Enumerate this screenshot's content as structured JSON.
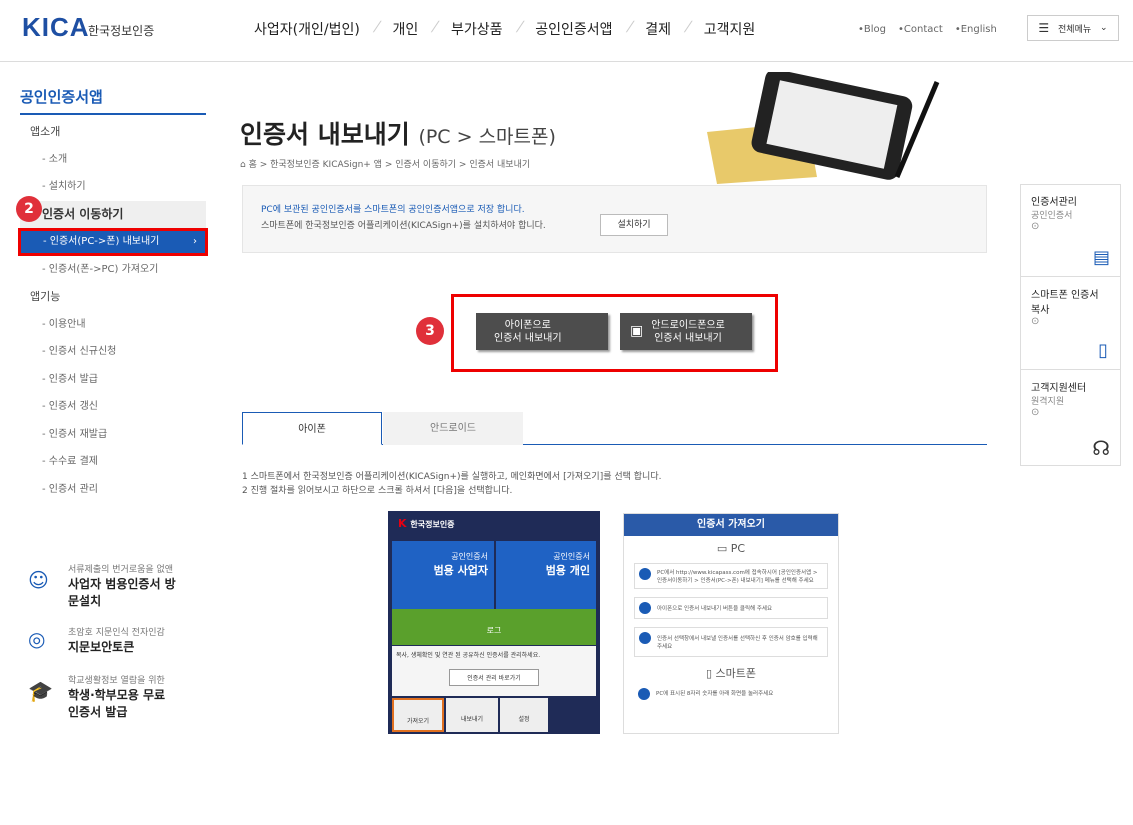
{
  "header": {
    "logo": "KICA",
    "logo_sub": "한국정보인증",
    "nav": [
      "사업자(개인/법인)",
      "개인",
      "부가상품",
      "공인인증서앱",
      "결제",
      "고객지원"
    ],
    "util": [
      "•Blog",
      "•Contact",
      "•English"
    ],
    "all_menu": "전체메뉴"
  },
  "sidebar": {
    "title": "공인인증서앱",
    "items": [
      {
        "label": "앱소개",
        "type": "grp"
      },
      {
        "label": "- 소개",
        "type": "sub"
      },
      {
        "label": "- 설치하기",
        "type": "sub"
      },
      {
        "label": "인증서 이동하기",
        "type": "on-grp"
      },
      {
        "label": "- 인증서(PC->폰) 내보내기",
        "type": "active"
      },
      {
        "label": "- 인증서(폰->PC) 가져오기",
        "type": "sub"
      },
      {
        "label": "앱기능",
        "type": "grp"
      },
      {
        "label": "- 이용안내",
        "type": "sub"
      },
      {
        "label": "- 인증서 신규신청",
        "type": "sub"
      },
      {
        "label": "- 인증서 발급",
        "type": "sub"
      },
      {
        "label": "- 인증서 갱신",
        "type": "sub"
      },
      {
        "label": "- 인증서 재발급",
        "type": "sub"
      },
      {
        "label": "- 수수료 결제",
        "type": "sub"
      },
      {
        "label": "- 인증서 관리",
        "type": "sub"
      }
    ],
    "banners": [
      {
        "small": "서류제출의 번거로움을 없앤",
        "big": "사업자 범용인증서 방문설치"
      },
      {
        "small": "초암호 지문인식 전자인감",
        "big": "지문보안토큰"
      },
      {
        "small": "학교생활정보 열람을 위한",
        "big": "학생·학부모용 무료인증서 발급"
      }
    ]
  },
  "main": {
    "title": "인증서 내보내기",
    "title_sub": "(PC > 스마트폰)",
    "breadcrumb": "⌂ 홈 > 한국정보인증 KICASign+ 앱 > 인증서 이동하기 > 인증서 내보내기",
    "info_line1": "PC에 보관된 공인인증서를 스마트폰의 공인인증서앱으로 저장 합니다.",
    "info_line2": "스마트폰에 한국정보인증 어플리케이션(KICASign+)를 설치하셔야 합니다.",
    "install_btn": "설치하기",
    "iphone_btn": [
      "아이폰으로",
      "인증서 내보내기"
    ],
    "android_btn": [
      "안드로이드폰으로",
      "인증서 내보내기"
    ],
    "tabs": [
      "아이폰",
      "안드로이드"
    ],
    "desc1": "1 스마트폰에서 한국정보인증 어플리케이션(KICASign+)를 실행하고, 메인화면에서 [가져오기]를 선택 합니다.",
    "desc2": "2 진행 절차를 읽어보시고 하단으로 스크롤 하셔서 [다음]을 선택합니다.",
    "phone1": {
      "brand": "한국정보인증",
      "left_small": "공인인증서",
      "left_big": "범용 사업자",
      "right_small": "공인인증서",
      "right_big": "범용 개인",
      "banner": "로그",
      "notice": "복사, 생체확인 및 연관 된 공유하신 인증서를 관리하세요.",
      "mgmt_btn": "인증서 관리 바로가기",
      "bottom": [
        "가져오기",
        "내보내기",
        "설정"
      ]
    },
    "phone2": {
      "header": "인증서 가져오기",
      "pc": "PC",
      "smart": "스마트폰",
      "steps": [
        "PC에서 http://www.kicapass.com에 접속하시어 [공인인증서앱 > 인증서이동하기 > 인증서(PC->폰) 내보내기] 메뉴를 선택해 주세요",
        "아이폰으로 인증서 내보내기 버튼을 클릭해 주세요",
        "인증서 선택창에서 내보낼 인증서를 선택하신 후 인증서 암호를 입력해 주세요",
        "PC에 표시된 8자리 숫자를 아래 화면을 눌러주세요"
      ]
    }
  },
  "right_quick": [
    {
      "title": "인증서관리",
      "sub": "공인인증서"
    },
    {
      "title": "스마트폰 인증서 복사",
      "sub": ""
    },
    {
      "title": "고객지원센터",
      "sub": "원격지원"
    }
  ],
  "markers": [
    "2",
    "3"
  ]
}
